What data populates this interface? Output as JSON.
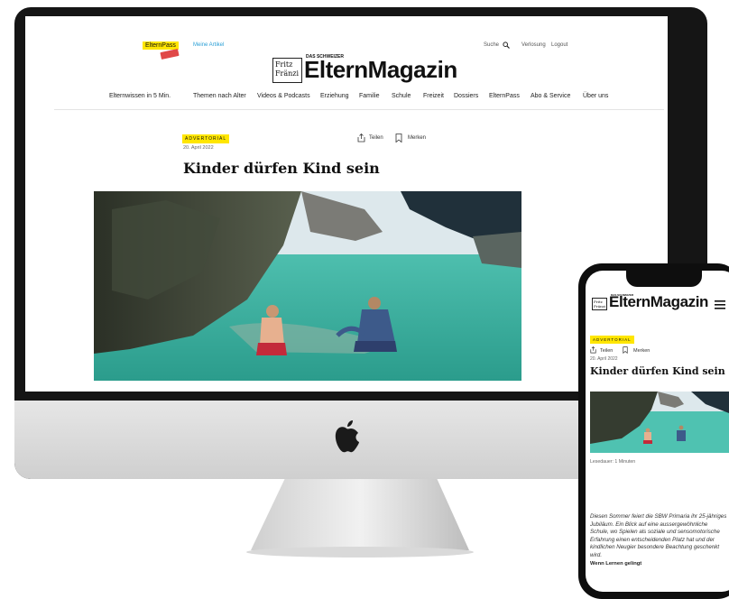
{
  "header": {
    "elternpass_label": "ElternPass",
    "my_articles": "Meine Artikel",
    "search": "Suche",
    "lottery": "Verlosung",
    "logout": "Logout",
    "logo_small1": "Fritz",
    "logo_small2": "Fränzi",
    "logo_tagline": "DAS SCHWEIZER",
    "logo_main": "ElternMagazin"
  },
  "nav": [
    "Elternwissen in 5 Min.",
    "Themen nach Alter",
    "Videos & Podcasts",
    "Erziehung",
    "Familie",
    "Schule",
    "Freizeit",
    "Dossiers",
    "ElternPass",
    "Abo & Service",
    "Über uns"
  ],
  "article": {
    "label": "ADVERTORIAL",
    "date": "20. April 2022",
    "share": "Teilen",
    "bookmark": "Merken",
    "title": "Kinder dürfen Kind sein"
  },
  "mobile": {
    "logo_main": "ElternMagazin",
    "reading_time": "Lesedauer: 1 Minuten",
    "intro": "Diesen Sommer feiert die SBW Primaria ihr 25-jähriges Jubiläum. Ein Blick auf eine aussergewöhnliche Schule, wo Spielen als soziale und sensomotorische Erfahrung einen entscheidenden Platz hat und der kindlichen Neugier besondere Beachtung geschenkt wird.",
    "subheading": "Wenn Lernen gelingt"
  },
  "colors": {
    "accent_yellow": "#ffe600",
    "link_blue": "#2a9fd6",
    "text": "#111111"
  }
}
